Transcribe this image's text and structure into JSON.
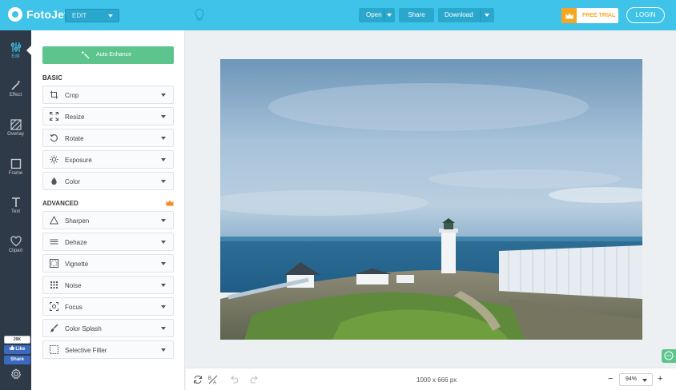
{
  "app": {
    "name": "FotoJet"
  },
  "header": {
    "mode": "EDIT",
    "open_label": "Open",
    "share_label": "Share",
    "download_label": "Download",
    "free_trial_label": "FREE TRIAL",
    "login_label": "LOGIN"
  },
  "nav": [
    {
      "label": "Edit",
      "icon": "sliders-icon"
    },
    {
      "label": "Effect",
      "icon": "magic-wand-icon"
    },
    {
      "label": "Overlay",
      "icon": "overlay-icon"
    },
    {
      "label": "Frame",
      "icon": "frame-icon"
    },
    {
      "label": "Text",
      "icon": "text-icon"
    },
    {
      "label": "Clipart",
      "icon": "heart-icon"
    }
  ],
  "social": {
    "like_count": "29K",
    "like_label": "Like",
    "share_label": "Share"
  },
  "panel": {
    "auto_enhance_label": "Auto Enhance",
    "basic_title": "BASIC",
    "advanced_title": "ADVANCED",
    "basic_tools": [
      {
        "label": "Crop",
        "icon": "crop-icon"
      },
      {
        "label": "Resize",
        "icon": "resize-icon"
      },
      {
        "label": "Rotate",
        "icon": "rotate-icon"
      },
      {
        "label": "Exposure",
        "icon": "sun-icon"
      },
      {
        "label": "Color",
        "icon": "drop-icon"
      }
    ],
    "advanced_tools": [
      {
        "label": "Sharpen",
        "icon": "triangle-icon"
      },
      {
        "label": "Dehaze",
        "icon": "lines-icon"
      },
      {
        "label": "Vignette",
        "icon": "vignette-icon"
      },
      {
        "label": "Noise",
        "icon": "grid-icon"
      },
      {
        "label": "Focus",
        "icon": "focus-icon"
      },
      {
        "label": "Color Splash",
        "icon": "brush-icon"
      },
      {
        "label": "Selective Filter",
        "icon": "dashed-square-icon"
      }
    ]
  },
  "canvas": {
    "dimensions": "1000 x 666 px"
  },
  "zoom": {
    "value": "94%",
    "minus": "−",
    "plus": "+"
  },
  "colors": {
    "accent": "#3fc3e8",
    "green": "#5cc48c",
    "sidebar": "#2f3a48",
    "trial": "#f5a623"
  }
}
